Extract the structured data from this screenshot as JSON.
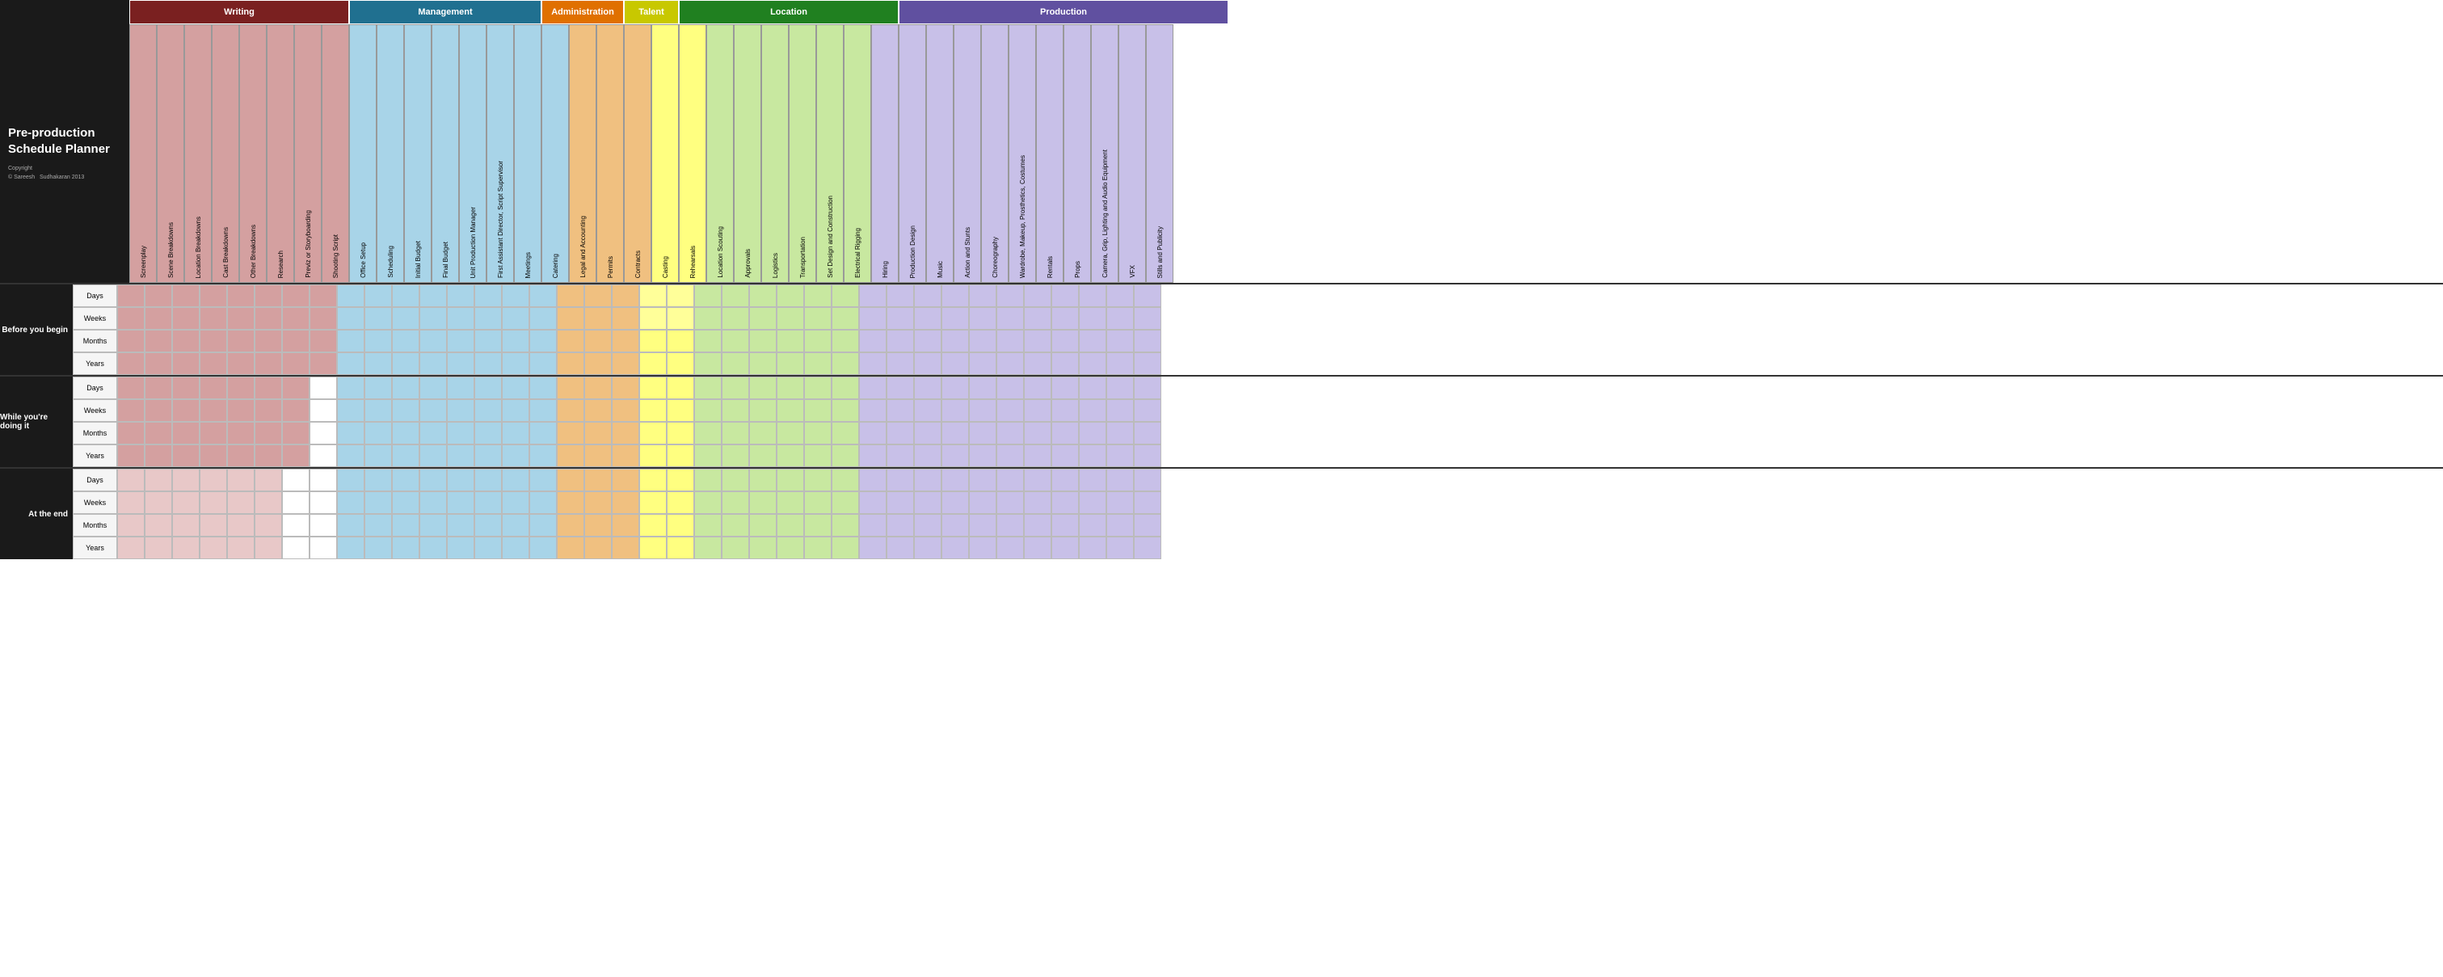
{
  "title": {
    "main": "Pre-production Schedule Planner",
    "copyright_line1": "Copyright",
    "copyright_line2": "© Sareesh    Sudhakaran 2013"
  },
  "categories": [
    {
      "id": "writing",
      "label": "Writing",
      "color": "#7a2020",
      "cols": 8
    },
    {
      "id": "management",
      "label": "Management",
      "color": "#207090",
      "cols": 7
    },
    {
      "id": "administration",
      "label": "Administration",
      "color": "#e07000",
      "cols": 3
    },
    {
      "id": "talent",
      "label": "Talent",
      "color": "#c8c800",
      "cols": 2
    },
    {
      "id": "location",
      "label": "Location",
      "color": "#208020",
      "cols": 8
    },
    {
      "id": "production",
      "label": "Production",
      "color": "#6050a0",
      "cols": 12
    }
  ],
  "columns": [
    {
      "id": "screenplay",
      "label": "Screenplay",
      "category": "writing"
    },
    {
      "id": "scene_breakdowns",
      "label": "Scene Breakdowns",
      "category": "writing"
    },
    {
      "id": "location_breakdowns",
      "label": "Location Breakdowns",
      "category": "writing"
    },
    {
      "id": "cast_breakdowns",
      "label": "Cast Breakdowns",
      "category": "writing"
    },
    {
      "id": "other_breakdowns",
      "label": "Other Breakdowns",
      "category": "writing"
    },
    {
      "id": "research",
      "label": "Research",
      "category": "writing"
    },
    {
      "id": "previz_storyboarding",
      "label": "Previz or Storyboarding",
      "category": "writing"
    },
    {
      "id": "shooting_script",
      "label": "Shooting Script",
      "category": "writing"
    },
    {
      "id": "office_setup",
      "label": "Office Setup",
      "category": "management"
    },
    {
      "id": "scheduling",
      "label": "Scheduling",
      "category": "management"
    },
    {
      "id": "initial_budget",
      "label": "Initial Budget",
      "category": "management"
    },
    {
      "id": "final_budget",
      "label": "Final Budget",
      "category": "management"
    },
    {
      "id": "unit_production_manager",
      "label": "Unit Production Manager",
      "category": "management"
    },
    {
      "id": "first_ad",
      "label": "First Assistant Director, Script Supervisor",
      "category": "management"
    },
    {
      "id": "meetings",
      "label": "Meetings",
      "category": "management"
    },
    {
      "id": "catering",
      "label": "Catering",
      "category": "management"
    },
    {
      "id": "legal_accounting",
      "label": "Legal and Accounting",
      "category": "administration"
    },
    {
      "id": "permits",
      "label": "Permits",
      "category": "administration"
    },
    {
      "id": "contracts",
      "label": "Contracts",
      "category": "administration"
    },
    {
      "id": "casting",
      "label": "Casting",
      "category": "talent"
    },
    {
      "id": "rehearsals",
      "label": "Rehearsals",
      "category": "talent"
    },
    {
      "id": "location_scouting",
      "label": "Location Scouting",
      "category": "location"
    },
    {
      "id": "approvals",
      "label": "Approvals",
      "category": "location"
    },
    {
      "id": "logistics",
      "label": "Logistics",
      "category": "location"
    },
    {
      "id": "transportation",
      "label": "Transportation",
      "category": "location"
    },
    {
      "id": "set_design",
      "label": "Set Design and Construction",
      "category": "location"
    },
    {
      "id": "electrical_rigging",
      "label": "Electrical Rigging",
      "category": "location"
    },
    {
      "id": "hiring",
      "label": "Hiring",
      "category": "production"
    },
    {
      "id": "production_design",
      "label": "Production Design",
      "category": "production"
    },
    {
      "id": "music",
      "label": "Music",
      "category": "production"
    },
    {
      "id": "action_stunts",
      "label": "Action and Stunts",
      "category": "production"
    },
    {
      "id": "choreography",
      "label": "Choreography",
      "category": "production"
    },
    {
      "id": "wardrobe",
      "label": "Wardrobe, Makeup, Prosthetics, Costumes",
      "category": "production"
    },
    {
      "id": "rentals",
      "label": "Rentals",
      "category": "production"
    },
    {
      "id": "props",
      "label": "Props",
      "category": "production"
    },
    {
      "id": "camera_grip",
      "label": "Camera, Grip, Lighting and Audio Equipment",
      "category": "production"
    },
    {
      "id": "vfx",
      "label": "VFX",
      "category": "production"
    },
    {
      "id": "stills_publicity",
      "label": "Stills and Publicity",
      "category": "production"
    }
  ],
  "sections": [
    {
      "id": "before_you_begin",
      "label": "Before you begin",
      "rows": [
        "Days",
        "Weeks",
        "Months",
        "Years"
      ]
    },
    {
      "id": "while_youre_doing_it",
      "label": "While you're doing it",
      "rows": [
        "Days",
        "Weeks",
        "Months",
        "Years"
      ]
    },
    {
      "id": "at_the_end",
      "label": "At the end",
      "rows": [
        "Days",
        "Weeks",
        "Months",
        "Years"
      ]
    }
  ],
  "colors": {
    "writing_bg": "#d4a0a0",
    "writing_header": "#7a2020",
    "management_bg": "#a8d4e8",
    "management_header": "#207090",
    "administration_bg": "#f0c080",
    "administration_header": "#e07000",
    "talent_bg": "#ffff80",
    "talent_header": "#c8c800",
    "location_bg": "#c8e8a0",
    "location_header": "#208020",
    "production_bg": "#c8c0e8",
    "production_header": "#6050a0"
  }
}
